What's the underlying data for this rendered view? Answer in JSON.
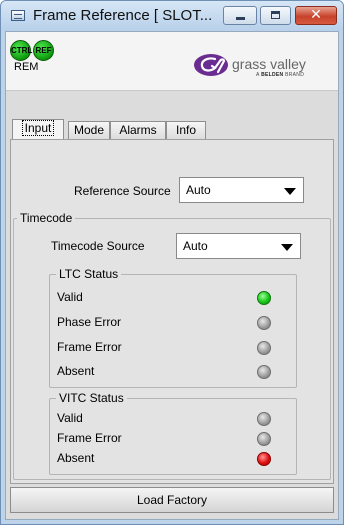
{
  "window": {
    "title": "Frame Reference [ SLOT...",
    "close_glyph": "✕"
  },
  "header": {
    "ctrl_label": "CTRL",
    "ref_label": "REF",
    "rem_label": "REM",
    "logo_text": "grass valley",
    "logo_sub_prefix": "A ",
    "logo_sub_brand": "BELDEN",
    "logo_sub_suffix": " BRAND"
  },
  "tabs": [
    {
      "label": "Input",
      "active": true
    },
    {
      "label": "Mode",
      "active": false
    },
    {
      "label": "Alarms",
      "active": false
    },
    {
      "label": "Info",
      "active": false
    }
  ],
  "input": {
    "reference_source_label": "Reference Source",
    "reference_source_value": "Auto",
    "timecode_group_title": "Timecode",
    "timecode_source_label": "Timecode Source",
    "timecode_source_value": "Auto",
    "ltc": {
      "title": "LTC Status",
      "items": [
        {
          "label": "Valid",
          "status": "green"
        },
        {
          "label": "Phase Error",
          "status": "gray"
        },
        {
          "label": "Frame Error",
          "status": "gray"
        },
        {
          "label": "Absent",
          "status": "gray"
        }
      ]
    },
    "vitc": {
      "title": "VITC Status",
      "items": [
        {
          "label": "Valid",
          "status": "gray"
        },
        {
          "label": "Frame Error",
          "status": "gray"
        },
        {
          "label": "Absent",
          "status": "red"
        }
      ]
    }
  },
  "footer": {
    "load_factory_label": "Load Factory"
  },
  "colors": {
    "led_green": "#19c619",
    "led_gray": "#9a9a9a",
    "led_red": "#e01010",
    "logo_purple": "#6a2c91"
  }
}
